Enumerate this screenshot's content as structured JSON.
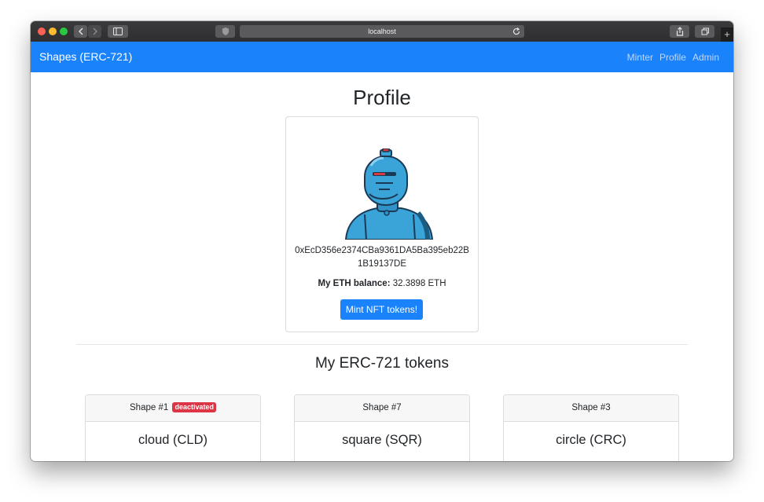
{
  "browser": {
    "url": "localhost",
    "icons": [
      "back-icon",
      "forward-icon",
      "sidebar-icon",
      "shield-icon",
      "reload-icon",
      "share-icon",
      "tabs-icon",
      "new-tab-icon"
    ]
  },
  "navbar": {
    "brand": "Shapes (ERC-721)",
    "links": [
      "Minter",
      "Profile",
      "Admin"
    ],
    "color": "#1a82fb"
  },
  "profile": {
    "title": "Profile",
    "address": "0xEcD356e2374CBa9361DA5Ba395eb22B1B19137DE",
    "balance_label": "My ETH balance:",
    "balance_value": "32.3898 ETH",
    "mint_button": "Mint NFT tokens!"
  },
  "tokens": {
    "title": "My ERC-721 tokens",
    "items": [
      {
        "header": "Shape #1",
        "badge": "deactivated",
        "name": "cloud (CLD)"
      },
      {
        "header": "Shape #7",
        "badge": "",
        "name": "square (SQR)"
      },
      {
        "header": "Shape #3",
        "badge": "",
        "name": "circle (CRC)"
      }
    ]
  },
  "colors": {
    "primary": "#1a82fb",
    "danger": "#dc3545"
  }
}
